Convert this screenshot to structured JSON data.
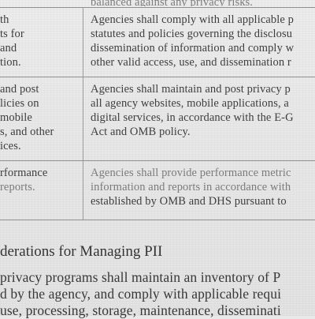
{
  "table": {
    "top_fragment": "balanced against any privacy risks.",
    "rows": [
      {
        "left_lines": [
          "th",
          "ts for",
          "and",
          "tion."
        ],
        "right_lines": [
          "Agencies shall comply with all applicable p",
          "statutes and policies governing the disclosu",
          "dissemination of information and comply w",
          "other valid access, use, and dissemination r"
        ]
      },
      {
        "left_lines": [
          "and post",
          "licies on",
          "mobile",
          "s, and other",
          "ices."
        ],
        "right_lines": [
          "Agencies shall maintain and post privacy p",
          "all agency websites, mobile applications, a",
          "digital services, in accordance with the E-G",
          "Act and OMB policy."
        ]
      },
      {
        "left_lines": [
          "rformance",
          "reports."
        ],
        "right_lines": [
          "Agencies shall provide performance metric",
          "information and reports in accordance with",
          "established by OMB and DHS pursuant to"
        ]
      }
    ]
  },
  "section": {
    "heading": "derations for Managing PII",
    "body_lines": [
      "privacy programs shall maintain an inventory of P",
      "d by the agency, and comply with applicable requi",
      "use, processing, storage, maintenance, disseminati"
    ]
  }
}
